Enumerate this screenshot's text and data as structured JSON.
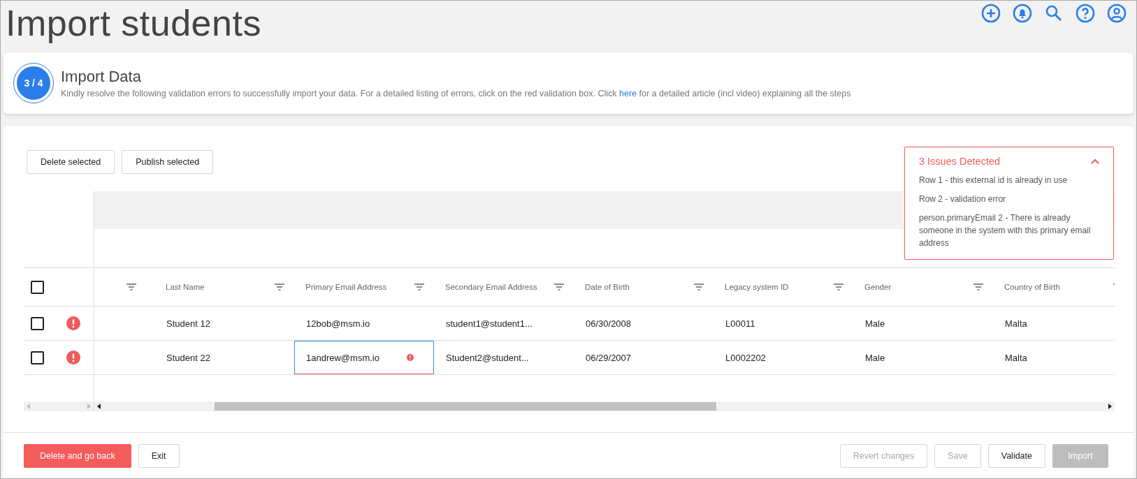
{
  "page": {
    "title": "Import students"
  },
  "step": {
    "badge": "3 / 4",
    "title": "Import Data",
    "text_before": "Kindly resolve the following validation errors to successfully import your data. For a detailed listing of errors, click on the red validation box. Click",
    "link": "here",
    "text_after": "for a detailed article (incl video) explaining all the steps"
  },
  "toolbar": {
    "buttons": [
      "Delete selected",
      "Publish selected"
    ]
  },
  "issues": {
    "title": "3 Issues Detected",
    "expanded": true,
    "items": [
      "Row 1 - this external id is already in use",
      "Row 2 - validation error",
      "person.primaryEmail 2 - There is already someone in the system with this primary email address"
    ]
  },
  "table": {
    "select_all": {
      "checked": false
    },
    "columns": [
      "Last Name",
      "Primary Email Address",
      "Secondary Email Address",
      "Date of Birth",
      "Legacy system ID",
      "Gender",
      "Country of Birth"
    ],
    "rows": [
      {
        "checked": false,
        "error": true,
        "cells": [
          {
            "text": "Student 12",
            "invalid": false,
            "focused": false
          },
          {
            "text": "12bob@msm.io",
            "invalid": false,
            "focused": false
          },
          {
            "text": "student1@student1...",
            "invalid": false,
            "focused": false
          },
          {
            "text": "06/30/2008",
            "invalid": false,
            "focused": false
          },
          {
            "text": "L00011",
            "invalid": false,
            "focused": false
          },
          {
            "text": "Male",
            "invalid": false,
            "focused": false
          },
          {
            "text": "Malta",
            "invalid": false,
            "focused": false
          }
        ]
      },
      {
        "checked": false,
        "error": true,
        "cells": [
          {
            "text": "Student 22",
            "invalid": false,
            "focused": false
          },
          {
            "text": "1andrew@msm.io",
            "invalid": true,
            "focused": true
          },
          {
            "text": "Student2@student...",
            "invalid": false,
            "focused": false
          },
          {
            "text": "06/29/2007",
            "invalid": false,
            "focused": false
          },
          {
            "text": "L0002202",
            "invalid": false,
            "focused": false
          },
          {
            "text": "Male",
            "invalid": false,
            "focused": false
          },
          {
            "text": "Malta",
            "invalid": false,
            "focused": false
          }
        ]
      }
    ]
  },
  "footer": {
    "left": [
      {
        "label": "Delete and go back",
        "kind": "danger",
        "disabled": false
      },
      {
        "label": "Exit",
        "kind": "outline",
        "disabled": false
      }
    ],
    "right": [
      {
        "label": "Revert changes",
        "kind": "outline",
        "disabled": true
      },
      {
        "label": "Save",
        "kind": "outline",
        "disabled": true
      },
      {
        "label": "Validate",
        "kind": "outline",
        "disabled": false
      },
      {
        "label": "Import",
        "kind": "primary",
        "disabled": true
      }
    ]
  }
}
